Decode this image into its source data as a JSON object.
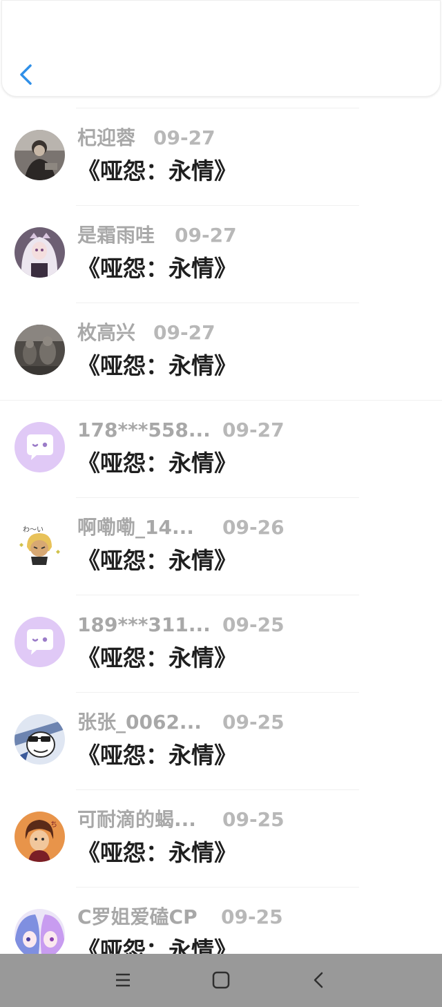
{
  "header": {
    "back_icon": "chevron-left-icon",
    "accent": "#2f8fe8"
  },
  "items": [
    {
      "name": "杞迎蓉",
      "date": "09-27",
      "title": "《哑怨：永情》",
      "avatar": "photo-person"
    },
    {
      "name": "是霜雨哇",
      "date": "09-27",
      "title": "《哑怨：永情》",
      "avatar": "anime-girl-white-hair"
    },
    {
      "name": "枚高兴",
      "date": "09-27",
      "title": "《哑怨：永情》",
      "avatar": "photo-stone-statues"
    },
    {
      "name": "178***558...",
      "date": "09-27",
      "title": "《哑怨：永情》",
      "avatar": "default-chat-bubble"
    },
    {
      "name": "啊嘞嘞_14...",
      "date": "09-26",
      "title": "《哑怨：永情》",
      "avatar": "cartoon-blonde-boy"
    },
    {
      "name": "189***311...",
      "date": "09-25",
      "title": "《哑怨：永情》",
      "avatar": "default-chat-bubble"
    },
    {
      "name": "张张_0062...",
      "date": "09-25",
      "title": "《哑怨：永情》",
      "avatar": "cartoon-sunglasses-character"
    },
    {
      "name": "可耐滴的蝎...",
      "date": "09-25",
      "title": "《哑怨：永情》",
      "avatar": "cartoon-brown-hair-boy"
    },
    {
      "name": "C罗姐爱磕CP",
      "date": "09-25",
      "title": "《哑怨：永情》",
      "avatar": "anime-two-girls"
    }
  ],
  "navbar": {
    "menu_icon": "menu-icon",
    "home_icon": "home-square-icon",
    "back_icon": "back-triangle-icon"
  }
}
